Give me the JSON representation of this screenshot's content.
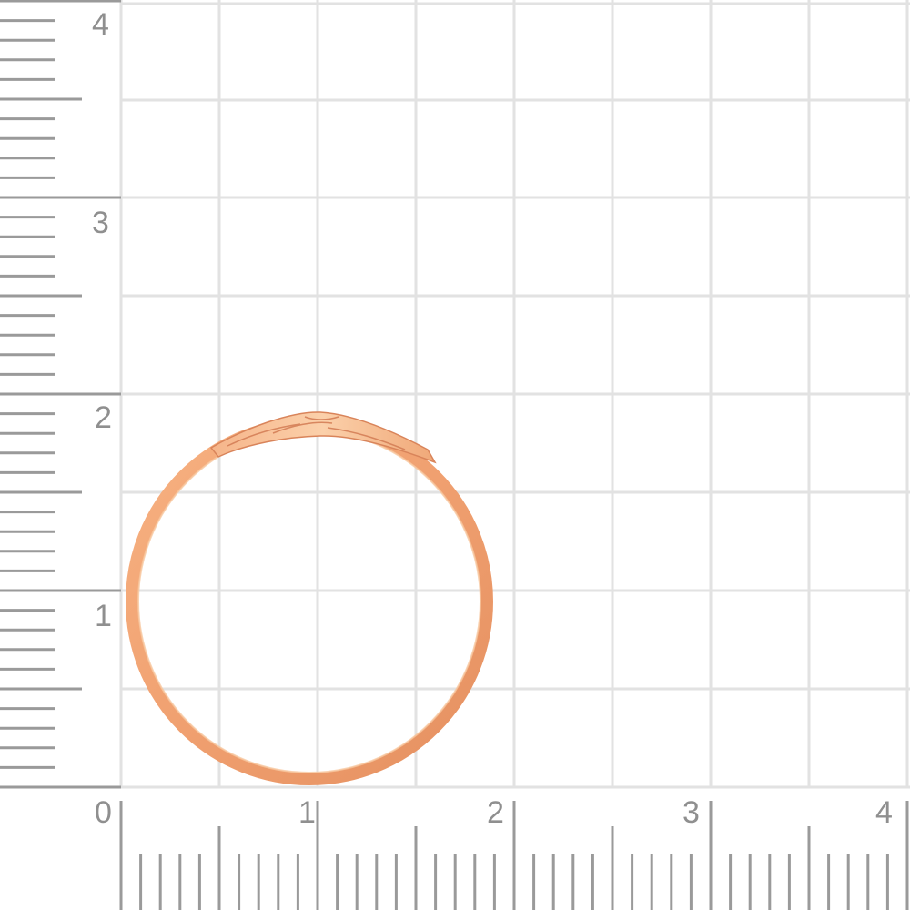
{
  "ruler": {
    "x_labels": [
      "0",
      "1",
      "2",
      "3",
      "4"
    ],
    "y_labels": [
      "1",
      "2",
      "3",
      "4"
    ],
    "tick_color": "#9a9a9a",
    "grid_color": "#e2e2e2",
    "label_color": "#8f8f8f"
  },
  "product": {
    "kind": "ring",
    "metal_color": "#f0a070",
    "highlight_color": "#f8c8a0",
    "shadow_color": "#d9845a"
  }
}
